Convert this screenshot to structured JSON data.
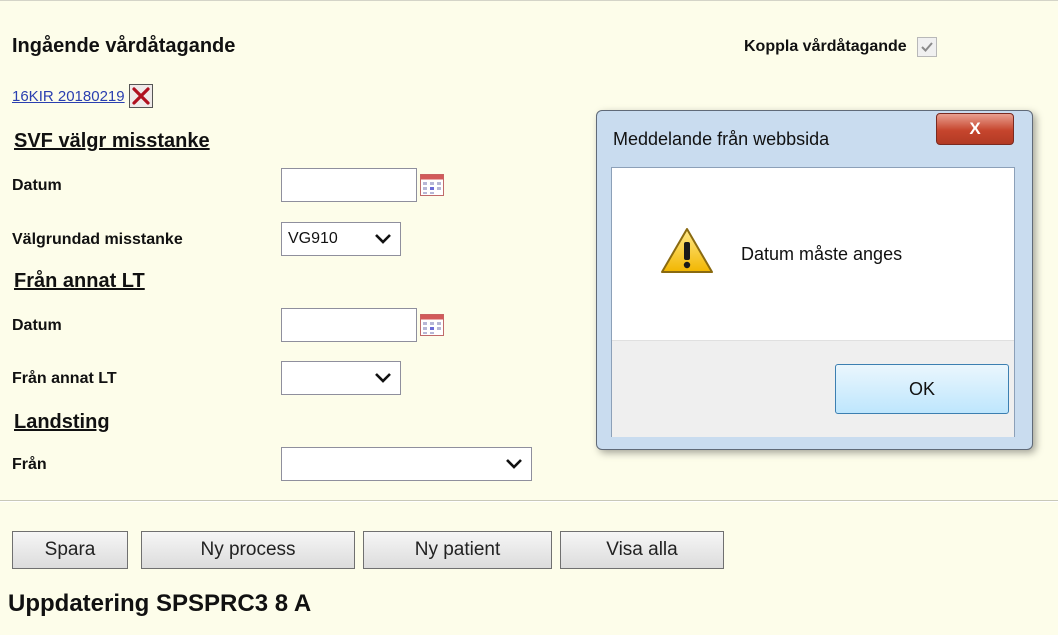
{
  "form": {
    "title": "Ingående vårdåtagande",
    "link_text": "16KIR 20180219",
    "koppla_label": "Koppla vårdåtagande",
    "koppla_checked": true,
    "sections": {
      "svf": "SVF välgr misstanke",
      "annat_lt": "Från annat LT",
      "landsting": "Landsting"
    },
    "labels": {
      "datum1": "Datum",
      "valgrundad": "Välgrundad misstanke",
      "datum2": "Datum",
      "fran_annat": "Från annat LT",
      "fran": "Från"
    },
    "values": {
      "datum1": "",
      "valgrundad_selected": "VG910",
      "datum2": "",
      "fran_annat_selected": "",
      "fran_selected": ""
    }
  },
  "buttons": {
    "spara": "Spara",
    "ny_process": "Ny process",
    "ny_patient": "Ny patient",
    "visa_alla": "Visa alla"
  },
  "status_text": "Uppdatering SPSPRC3 8 A",
  "dialog": {
    "title": "Meddelande från webbsida",
    "close_glyph": "X",
    "message": "Datum måste anges",
    "ok_label": "OK"
  },
  "colors": {
    "page_bg": "#fdfdea",
    "link": "#2a3fb0",
    "dialog_frame": "#c9dcef"
  },
  "icons": [
    "delete-x-icon",
    "check-icon",
    "calendar-icon",
    "chevron-down-icon",
    "warning-icon",
    "close-icon"
  ]
}
